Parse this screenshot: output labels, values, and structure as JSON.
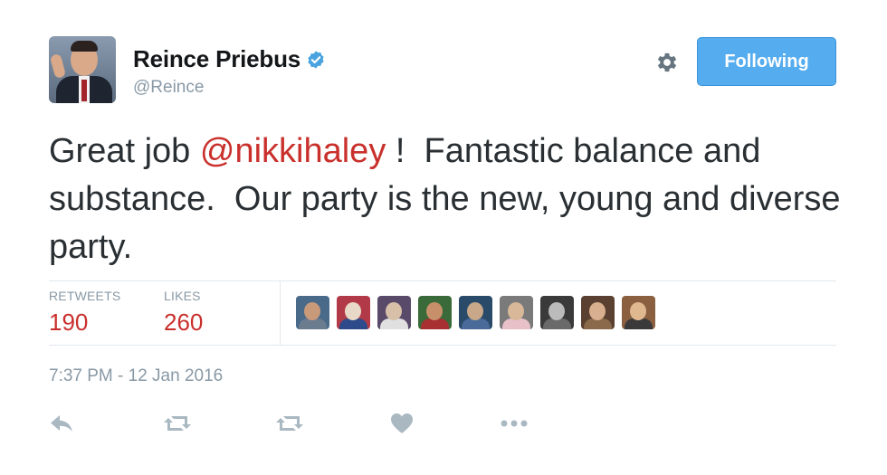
{
  "user": {
    "display_name": "Reince Priebus",
    "handle": "@Reince",
    "verified_icon": "verified-badge-icon",
    "verified_color": "#4aa3df"
  },
  "header": {
    "settings_icon": "gear-icon",
    "follow_button_label": "Following",
    "follow_button_color": "#55acee"
  },
  "tweet": {
    "text_before": "Great job ",
    "mention": "@nikkihaley",
    "text_after": " !  Fantastic balance and substance.  Our party is the new, young and diverse party.",
    "mention_color": "#c9302c"
  },
  "stats": {
    "retweets_label": "RETWEETS",
    "retweets_value": "190",
    "likes_label": "LIKES",
    "likes_value": "260",
    "value_color": "#c9302c"
  },
  "likers": [
    {
      "name": "liker-avatar-1",
      "bg": "#4a6a8a",
      "head": "#c99a7a",
      "body": "#6b7c8f"
    },
    {
      "name": "liker-avatar-2",
      "bg": "#b23a48",
      "head": "#e8d8c8",
      "body": "#2d4a8a"
    },
    {
      "name": "liker-avatar-3",
      "bg": "#5a4a6a",
      "head": "#d8c0a8",
      "body": "#e0e0e0"
    },
    {
      "name": "liker-avatar-4",
      "bg": "#3a6a3a",
      "head": "#c8906a",
      "body": "#a83030"
    },
    {
      "name": "liker-avatar-5",
      "bg": "#2a4a6a",
      "head": "#c8a888",
      "body": "#4a6a9a"
    },
    {
      "name": "liker-avatar-6",
      "bg": "#7a7a7a",
      "head": "#d8b898",
      "body": "#e8c0c8"
    },
    {
      "name": "liker-avatar-7",
      "bg": "#3a3a3a",
      "head": "#bbbbbb",
      "body": "#6a6a6a"
    },
    {
      "name": "liker-avatar-8",
      "bg": "#5a4030",
      "head": "#d8b090",
      "body": "#8a6a4a"
    },
    {
      "name": "liker-avatar-9",
      "bg": "#8a6040",
      "head": "#e0b890",
      "body": "#3a3a3a"
    }
  ],
  "timestamp": "7:37 PM - 12 Jan 2016",
  "actions": {
    "reply_icon": "reply-icon",
    "retweet_icon": "retweet-icon",
    "retweet2_icon": "retweet-icon",
    "like_icon": "heart-icon",
    "more_icon": "more-icon",
    "icon_color": "#aab8c2"
  }
}
